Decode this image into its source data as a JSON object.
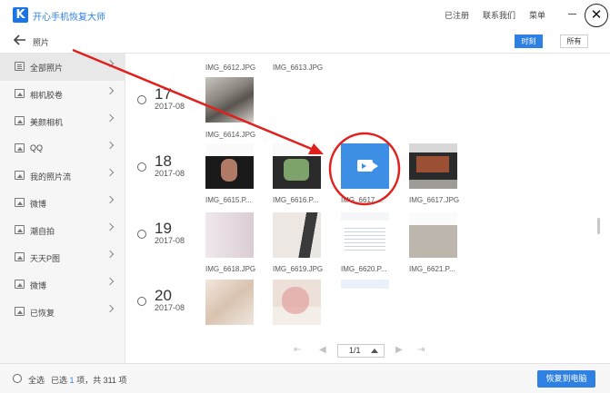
{
  "app": {
    "logo_letter": "K",
    "title": "开心手机恢复大师"
  },
  "topnav": {
    "registered": "已注册",
    "contact": "联系我们",
    "menu": "菜单",
    "close": "✕"
  },
  "subbar": {
    "back_icon": "left-arrow-icon",
    "title": "照片",
    "tab_time": "时刻",
    "tab_all": "所有"
  },
  "sidebar": {
    "items": [
      {
        "label": "全部照片",
        "icon": "document-icon"
      },
      {
        "label": "相机胶卷",
        "icon": "image-icon"
      },
      {
        "label": "美颜相机",
        "icon": "image-icon"
      },
      {
        "label": "QQ",
        "icon": "image-icon"
      },
      {
        "label": "我的照片流",
        "icon": "image-icon"
      },
      {
        "label": "微博",
        "icon": "image-icon"
      },
      {
        "label": "潮自拍",
        "icon": "image-icon"
      },
      {
        "label": "天天P图",
        "icon": "image-icon"
      },
      {
        "label": "微博",
        "icon": "image-icon"
      },
      {
        "label": "已恢复",
        "icon": "image-icon"
      }
    ]
  },
  "groups": [
    {
      "day": "17",
      "month": "2017-08"
    },
    {
      "day": "18",
      "month": "2017-08"
    },
    {
      "day": "19",
      "month": "2017-08"
    },
    {
      "day": "20",
      "month": "2017-08"
    }
  ],
  "files": {
    "top_names": [
      "IMG_6612.JPG",
      "IMG_6613.JPG"
    ],
    "g17_names": [
      "IMG_6614.JPG"
    ],
    "g18_names": [
      "IMG_6615.P...",
      "IMG_6616.P...",
      "IMG_6617....",
      "IMG_6617.JPG"
    ],
    "g19_names": [
      "IMG_6618.JPG",
      "IMG_6619.JPG",
      "IMG_6620.P...",
      "IMG_6621.P..."
    ]
  },
  "pager": {
    "first": "⇤",
    "prev": "◀",
    "page": "1/1",
    "next": "▶",
    "last": "⇥"
  },
  "footer": {
    "select_all": "全选",
    "selected_prefix": "已选",
    "selected_count": "1",
    "selected_mid": "项，共",
    "total": "311",
    "selected_suffix": "项",
    "recover_button": "恢复到电脑"
  },
  "colors": {
    "accent": "#2f80e3",
    "annotation": "#e0201c",
    "video_tile": "#3d8fe5"
  }
}
